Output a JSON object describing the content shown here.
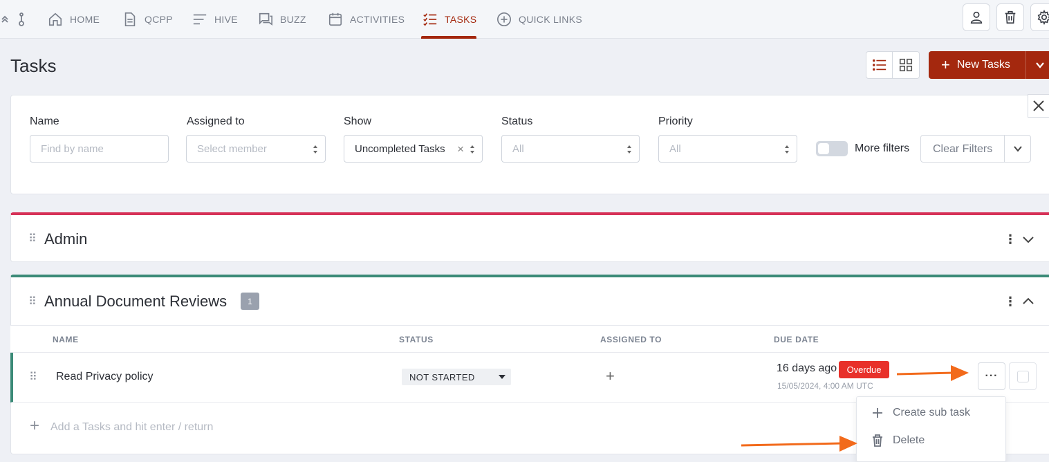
{
  "nav": {
    "items": [
      {
        "label": "HOME",
        "icon": "home-icon"
      },
      {
        "label": "QCPP",
        "icon": "document-icon"
      },
      {
        "label": "HIVE",
        "icon": "lines-icon"
      },
      {
        "label": "BUZZ",
        "icon": "chat-icon"
      },
      {
        "label": "ACTIVITIES",
        "icon": "calendar-icon"
      },
      {
        "label": "TASKS",
        "icon": "checklist-icon",
        "active": true
      },
      {
        "label": "QUICK LINKS",
        "icon": "plus-circle-icon"
      }
    ],
    "actions": [
      "user-icon",
      "trash-icon",
      "gear-icon"
    ]
  },
  "page": {
    "title": "Tasks",
    "new_button": "New Tasks"
  },
  "filters": {
    "name": {
      "label": "Name",
      "placeholder": "Find by name"
    },
    "assigned": {
      "label": "Assigned to",
      "placeholder": "Select member"
    },
    "show": {
      "label": "Show",
      "value": "Uncompleted Tasks"
    },
    "status": {
      "label": "Status",
      "value": "All"
    },
    "priority": {
      "label": "Priority",
      "value": "All"
    },
    "more_filters": "More filters",
    "clear": "Clear Filters"
  },
  "groups": [
    {
      "title": "Admin",
      "color": "#d63157"
    },
    {
      "title": "Annual Document Reviews",
      "color": "#3b8a77",
      "count": "1"
    }
  ],
  "table": {
    "headers": [
      "NAME",
      "STATUS",
      "ASSIGNED TO",
      "DUE DATE"
    ],
    "rows": [
      {
        "name": "Read Privacy policy",
        "status": "NOT STARTED",
        "due_relative": "16 days ago",
        "due_badge": "Overdue",
        "due_absolute": "15/05/2024, 4:00 AM UTC"
      }
    ],
    "add_placeholder": "Add a Tasks and hit enter / return"
  },
  "context_menu": {
    "items": [
      "Create sub task",
      "Delete"
    ]
  },
  "colors": {
    "accent": "#a4280e",
    "overdue": "#e8302a",
    "annotation_arrow": "#f26a1b"
  }
}
